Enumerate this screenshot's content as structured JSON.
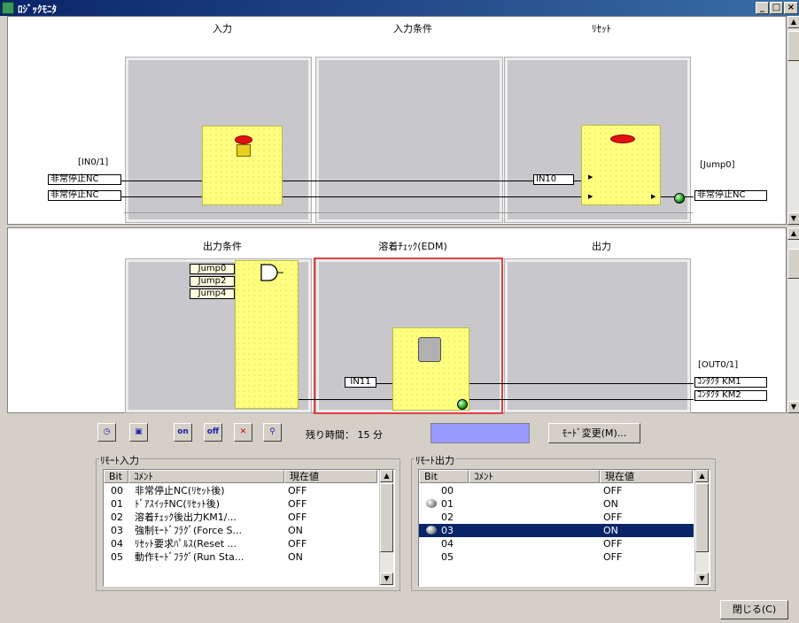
{
  "window": {
    "title": "ﾛｼﾞｯｸﾓﾆﾀ",
    "min": "_",
    "max": "□",
    "close": "×"
  },
  "upper": {
    "headers": [
      "入力",
      "入力条件",
      "ﾘｾｯﾄ"
    ],
    "in_label": "[IN0/1]",
    "in_tags": [
      "非常停止NC",
      "非常停止NC"
    ],
    "reset_input": "IN10",
    "jump_label": "[Jump0]",
    "out_tag": "非常停止NC"
  },
  "lower": {
    "headers": [
      "出力条件",
      "溶着ﾁｪｯｸ(EDM)",
      "出力"
    ],
    "jumps": [
      "Jump0",
      "Jump2",
      "Jump4"
    ],
    "edm_input": "IN11",
    "out_label": "[OUT0/1]",
    "out_tags": [
      "ｺﾝﾀｸﾀ KM1",
      "ｺﾝﾀｸﾀ KM2"
    ]
  },
  "toolbar": {
    "tb1": "◷",
    "tb2": "▣",
    "tb3": "on",
    "tb4": "off",
    "tb5": "✕",
    "tb6": "⚲",
    "remaining_label": "残り時間：",
    "remaining_value": "15 分",
    "mode_button": "ﾓｰﾄﾞ変更(M)...",
    "status_color": "#9999ff"
  },
  "remote_in": {
    "title": "ﾘﾓｰﾄ入力",
    "cols": [
      "Bit",
      "ｺﾒﾝﾄ",
      "現在値"
    ],
    "rows": [
      [
        "00",
        "非常停止NC(ﾘｾｯﾄ後)",
        "OFF"
      ],
      [
        "01",
        "ﾄﾞｱｽｲｯﾁNC(ﾘｾｯﾄ後)",
        "OFF"
      ],
      [
        "02",
        "溶着ﾁｪｯｸ後出力KM1/...",
        "OFF"
      ],
      [
        "03",
        "強制ﾓｰﾄﾞﾌﾗｸﾞ(Force S...",
        "ON"
      ],
      [
        "04",
        "ﾘｾｯﾄ要求ﾊﾟﾙｽ(Reset ...",
        "OFF"
      ],
      [
        "05",
        "動作ﾓｰﾄﾞﾌﾗｸﾞ(Run Sta...",
        "ON"
      ]
    ]
  },
  "remote_out": {
    "title": "ﾘﾓｰﾄ出力",
    "cols": [
      "Bit",
      "ｺﾒﾝﾄ",
      "現在値"
    ],
    "rows": [
      [
        "00",
        "",
        "OFF"
      ],
      [
        "01",
        "",
        "ON"
      ],
      [
        "02",
        "",
        "OFF"
      ],
      [
        "03",
        "",
        "ON"
      ],
      [
        "04",
        "",
        "OFF"
      ],
      [
        "05",
        "",
        "OFF"
      ]
    ]
  },
  "close_button": "閉じる(C)"
}
